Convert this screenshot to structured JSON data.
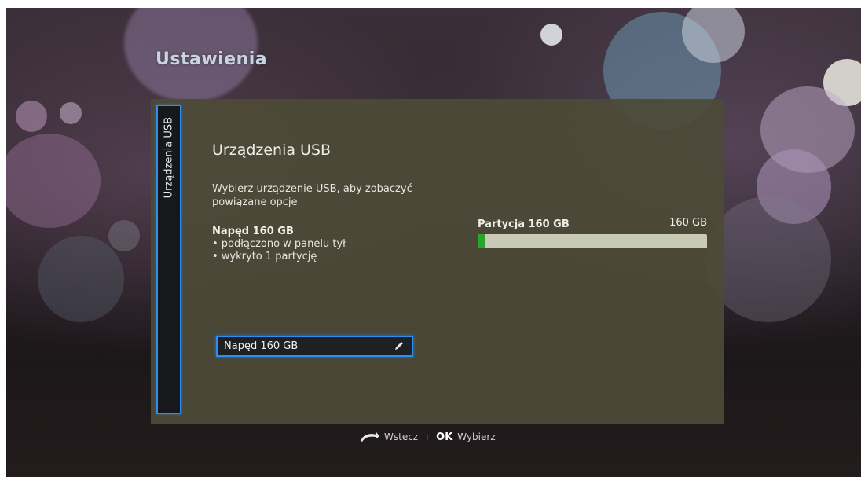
{
  "screen": {
    "title": "Ustawienia",
    "side_tab": {
      "label": "Urządzenia USB"
    },
    "content": {
      "heading": "Urządzenia USB",
      "description": "Wybierz urządzenie USB, aby zobaczyć powiązane opcje",
      "drive": {
        "name": "Napęd 160 GB",
        "details": [
          "• podłączono w panelu tył",
          "• wykryto 1 partycję"
        ]
      },
      "partition": {
        "label": "Partycja 160 GB",
        "size": "160 GB",
        "used_fraction": 0.03,
        "bar_color": "#2ba42e"
      },
      "selected_item": {
        "label": "Napęd 160 GB",
        "icon": "edit-icon"
      }
    },
    "footer": {
      "back_icon": "back-arrow-icon",
      "back_label": "Wstecz",
      "separator": "ı",
      "ok_key": "OK",
      "ok_label": "Wybierz"
    },
    "accent_color": "#2b8ef0"
  }
}
